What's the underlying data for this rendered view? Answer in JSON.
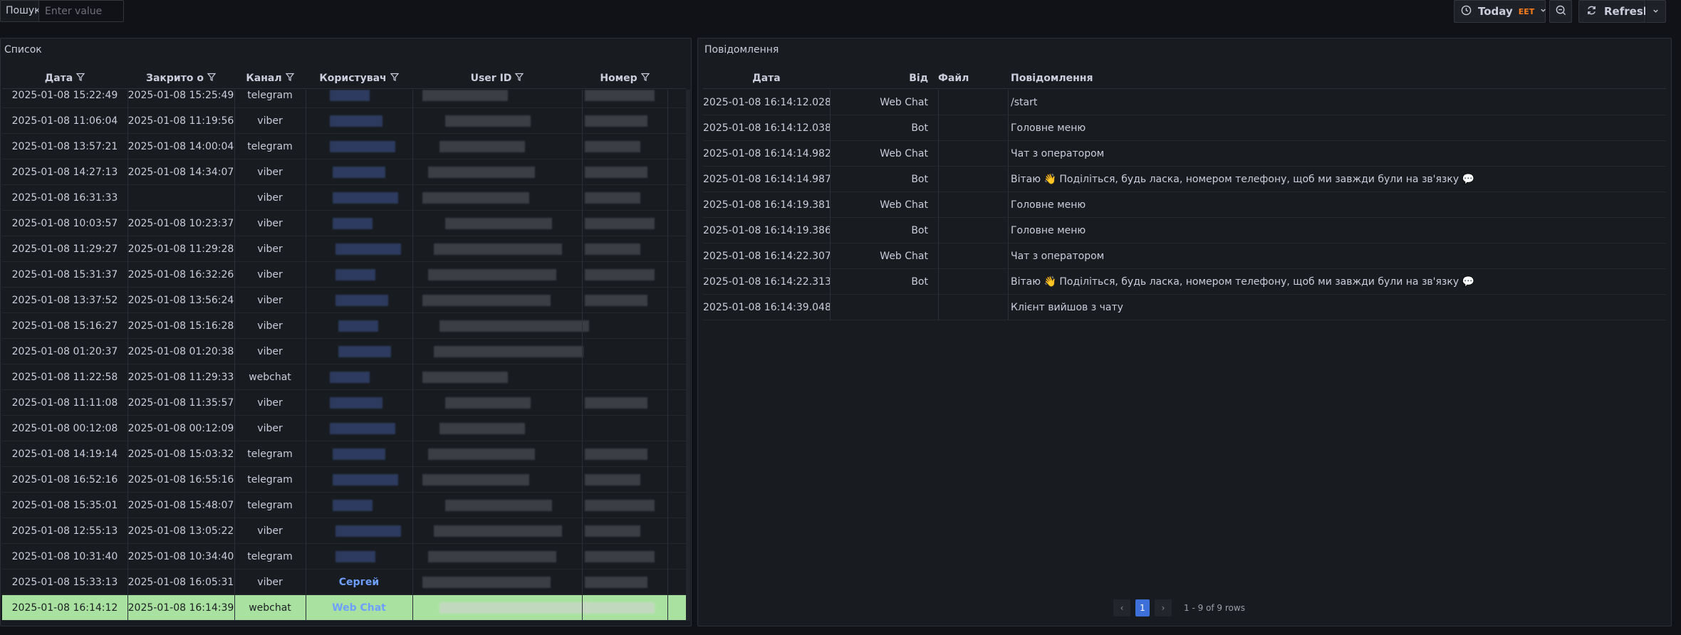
{
  "search": {
    "label": "Пошук",
    "placeholder": "Enter value"
  },
  "toolbar": {
    "time_range": "Today",
    "timezone": "EET",
    "refresh_label": "Refresh",
    "icons": [
      "clock-icon",
      "chevron-down-icon",
      "zoom-out-icon",
      "refresh-icon"
    ]
  },
  "left_panel": {
    "title": "Список",
    "columns": [
      "Дата",
      "Закрито о",
      "Канал",
      "Користувач",
      "User ID",
      "Номер"
    ],
    "rows": [
      {
        "date": "2025-01-08 15:22:49",
        "closed": "2025-01-08 15:25:49",
        "channel": "telegram",
        "user": ""
      },
      {
        "date": "2025-01-08 11:06:04",
        "closed": "2025-01-08 11:19:56",
        "channel": "viber",
        "user": ""
      },
      {
        "date": "2025-01-08 13:57:21",
        "closed": "2025-01-08 14:00:04",
        "channel": "telegram",
        "user": ""
      },
      {
        "date": "2025-01-08 14:27:13",
        "closed": "2025-01-08 14:34:07",
        "channel": "viber",
        "user": ""
      },
      {
        "date": "2025-01-08 16:31:33",
        "closed": "",
        "channel": "viber",
        "user": ""
      },
      {
        "date": "2025-01-08 10:03:57",
        "closed": "2025-01-08 10:23:37",
        "channel": "viber",
        "user": ""
      },
      {
        "date": "2025-01-08 11:29:27",
        "closed": "2025-01-08 11:29:28",
        "channel": "viber",
        "user": ""
      },
      {
        "date": "2025-01-08 15:31:37",
        "closed": "2025-01-08 16:32:26",
        "channel": "viber",
        "user": ""
      },
      {
        "date": "2025-01-08 13:37:52",
        "closed": "2025-01-08 13:56:24",
        "channel": "viber",
        "user": ""
      },
      {
        "date": "2025-01-08 15:16:27",
        "closed": "2025-01-08 15:16:28",
        "channel": "viber",
        "user": ""
      },
      {
        "date": "2025-01-08 01:20:37",
        "closed": "2025-01-08 01:20:38",
        "channel": "viber",
        "user": ""
      },
      {
        "date": "2025-01-08 11:22:58",
        "closed": "2025-01-08 11:29:33",
        "channel": "webchat",
        "user": ""
      },
      {
        "date": "2025-01-08 11:11:08",
        "closed": "2025-01-08 11:35:57",
        "channel": "viber",
        "user": ""
      },
      {
        "date": "2025-01-08 00:12:08",
        "closed": "2025-01-08 00:12:09",
        "channel": "viber",
        "user": ""
      },
      {
        "date": "2025-01-08 14:19:14",
        "closed": "2025-01-08 15:03:32",
        "channel": "telegram",
        "user": ""
      },
      {
        "date": "2025-01-08 16:52:16",
        "closed": "2025-01-08 16:55:16",
        "channel": "telegram",
        "user": ""
      },
      {
        "date": "2025-01-08 15:35:01",
        "closed": "2025-01-08 15:48:07",
        "channel": "telegram",
        "user": ""
      },
      {
        "date": "2025-01-08 12:55:13",
        "closed": "2025-01-08 13:05:22",
        "channel": "viber",
        "user": ""
      },
      {
        "date": "2025-01-08 10:31:40",
        "closed": "2025-01-08 10:34:40",
        "channel": "telegram",
        "user": ""
      },
      {
        "date": "2025-01-08 15:33:13",
        "closed": "2025-01-08 16:05:31",
        "channel": "viber",
        "user": "Сергей"
      },
      {
        "date": "2025-01-08 16:14:12",
        "closed": "2025-01-08 16:14:39",
        "channel": "webchat",
        "user": "Web Chat",
        "selected": true
      }
    ]
  },
  "right_panel": {
    "title": "Повідомлення",
    "columns": [
      "Дата",
      "Від",
      "Файл",
      "Повідомлення"
    ],
    "rows": [
      {
        "date": "2025-01-08 16:14:12.028",
        "from": "Web Chat",
        "file": "",
        "message": "/start"
      },
      {
        "date": "2025-01-08 16:14:12.038",
        "from": "Bot",
        "file": "",
        "message": "Головне меню"
      },
      {
        "date": "2025-01-08 16:14:14.982",
        "from": "Web Chat",
        "file": "",
        "message": "Чат з оператором"
      },
      {
        "date": "2025-01-08 16:14:14.987",
        "from": "Bot",
        "file": "",
        "message": "Вітаю 👋 Поділіться, будь ласка, номером телефону, щоб ми завжди були на зв'язку 💬"
      },
      {
        "date": "2025-01-08 16:14:19.381",
        "from": "Web Chat",
        "file": "",
        "message": "Головне меню"
      },
      {
        "date": "2025-01-08 16:14:19.386",
        "from": "Bot",
        "file": "",
        "message": "Головне меню"
      },
      {
        "date": "2025-01-08 16:14:22.307",
        "from": "Web Chat",
        "file": "",
        "message": "Чат з оператором"
      },
      {
        "date": "2025-01-08 16:14:22.313",
        "from": "Bot",
        "file": "",
        "message": "Вітаю 👋 Поділіться, будь ласка, номером телефону, щоб ми завжди були на зв'язку 💬"
      },
      {
        "date": "2025-01-08 16:14:39.048",
        "from": "",
        "file": "",
        "message": "Клієнт вийшов з чату"
      }
    ],
    "pagination": {
      "current_page": "1",
      "summary": "1 - 9 of 9 rows"
    }
  },
  "colors": {
    "background": "#111217",
    "panel": "#181b1f",
    "selected_row": "#a9e2a0",
    "accent": "#3d71d9",
    "timezone": "#ff7d1a"
  }
}
